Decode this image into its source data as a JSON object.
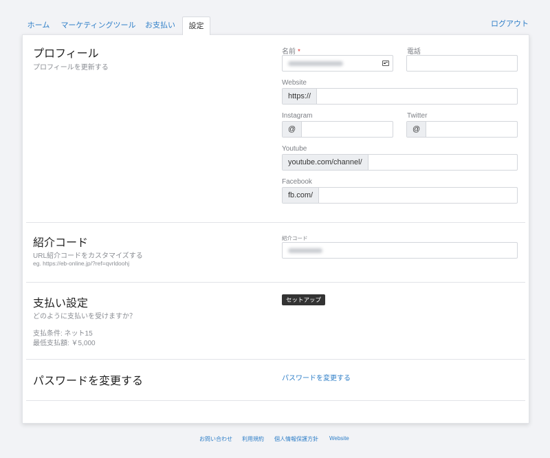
{
  "tabs": [
    {
      "label": "ホーム",
      "active": false
    },
    {
      "label": "マーケティングツール",
      "active": false
    },
    {
      "label": "お支払い",
      "active": false
    },
    {
      "label": "設定",
      "active": true
    }
  ],
  "logout_label": "ログアウト",
  "profile": {
    "title": "プロフィール",
    "subtitle": "プロフィールを更新する",
    "name_label": "名前",
    "name_required_mark": "*",
    "phone_label": "電話",
    "website_label": "Website",
    "website_prefix": "https://",
    "instagram_label": "Instagram",
    "instagram_prefix": "@",
    "twitter_label": "Twitter",
    "twitter_prefix": "@",
    "youtube_label": "Youtube",
    "youtube_prefix": "youtube.com/channel/",
    "facebook_label": "Facebook",
    "facebook_prefix": "fb.com/"
  },
  "referral": {
    "title": "紹介コード",
    "subtitle": "URL紹介コードをカスタマイズする",
    "example": "eg. https://eb-online.jp/?ref=qvrldoohj",
    "code_label": "紹介コード"
  },
  "payment": {
    "title": "支払い設定",
    "subtitle": "どのように支払いを受けますか？",
    "terms": "支払条件: ネット15",
    "minimum": "最低支払額: ￥5,000",
    "setup_button": "セットアップ"
  },
  "password": {
    "title": "パスワードを変更する",
    "link": "パスワードを変更する"
  },
  "footer": {
    "contact": "お問い合わせ",
    "terms": "利用規約",
    "privacy": "個人情報保護方針",
    "website": "Website"
  },
  "colors": {
    "accent": "#2f7fc8",
    "required": "#e0312f",
    "dark_button": "#333333",
    "background": "#f2f3f6"
  }
}
